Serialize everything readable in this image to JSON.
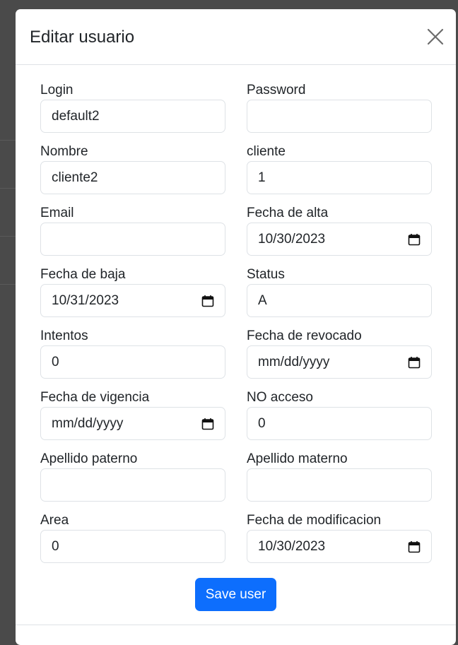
{
  "modal": {
    "title": "Editar usuario",
    "save_label": "Save user"
  },
  "fields": {
    "login": {
      "label": "Login",
      "value": "default2"
    },
    "password": {
      "label": "Password",
      "value": ""
    },
    "nombre": {
      "label": "Nombre",
      "value": "cliente2"
    },
    "cliente": {
      "label": "cliente",
      "value": "1"
    },
    "email": {
      "label": "Email",
      "value": ""
    },
    "fecha_alta": {
      "label": "Fecha de alta",
      "value": "10/30/2023"
    },
    "fecha_baja": {
      "label": "Fecha de baja",
      "value": "10/31/2023"
    },
    "status": {
      "label": "Status",
      "value": "A"
    },
    "intentos": {
      "label": "Intentos",
      "value": "0"
    },
    "fecha_revocado": {
      "label": "Fecha de revocado",
      "value": "mm/dd/yyyy"
    },
    "fecha_vigencia": {
      "label": "Fecha de vigencia",
      "value": "mm/dd/yyyy"
    },
    "no_acceso": {
      "label": "NO acceso",
      "value": "0"
    },
    "apellido_paterno": {
      "label": "Apellido paterno",
      "value": ""
    },
    "apellido_materno": {
      "label": "Apellido materno",
      "value": ""
    },
    "area": {
      "label": "Area",
      "value": "0"
    },
    "fecha_modificacion": {
      "label": "Fecha de modificacion",
      "value": "10/30/2023"
    }
  },
  "icons": {
    "close": "close-icon",
    "date": "calendar-icon"
  },
  "colors": {
    "primary": "#0d6efd",
    "border": "#dee2e6",
    "text": "#212529",
    "backdrop": "#4a4a4a"
  }
}
